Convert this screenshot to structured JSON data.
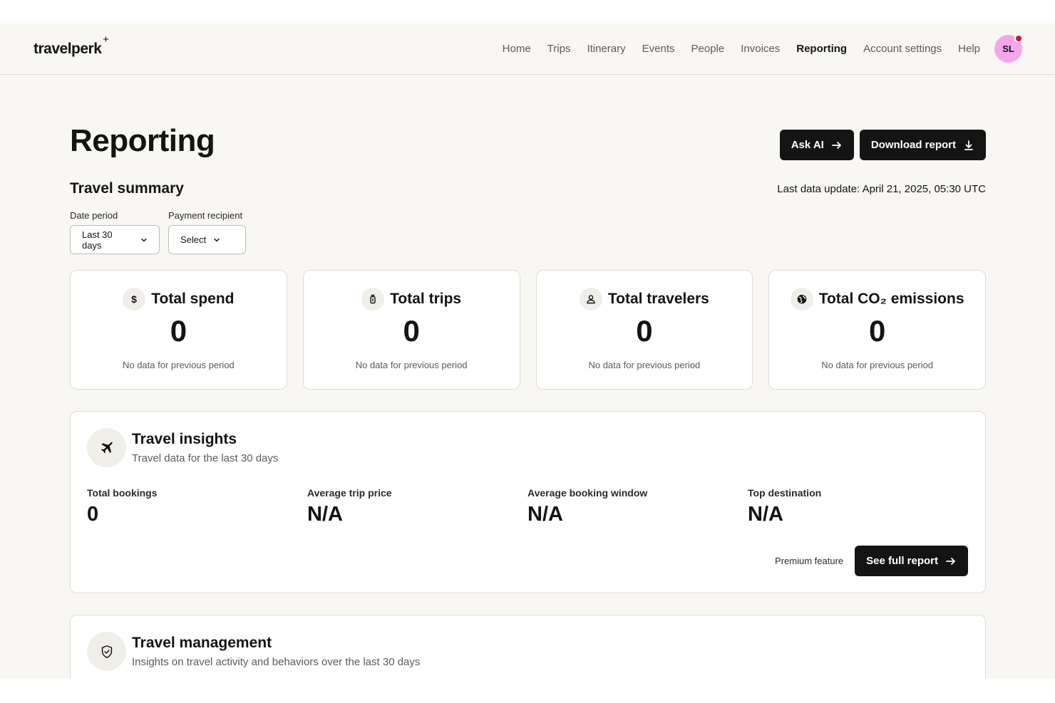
{
  "header": {
    "logo": "travelperk",
    "logo_mark": "+",
    "nav": [
      {
        "label": "Home",
        "active": false
      },
      {
        "label": "Trips",
        "active": false
      },
      {
        "label": "Itinerary",
        "active": false
      },
      {
        "label": "Events",
        "active": false
      },
      {
        "label": "People",
        "active": false
      },
      {
        "label": "Invoices",
        "active": false
      },
      {
        "label": "Reporting",
        "active": true
      },
      {
        "label": "Account settings",
        "active": false
      },
      {
        "label": "Help",
        "active": false
      }
    ],
    "avatar_initials": "SL"
  },
  "page": {
    "title": "Reporting",
    "ask_ai_label": "Ask AI",
    "download_label": "Download report",
    "section_title": "Travel summary",
    "last_update": "Last data update: April 21, 2025, 05:30 UTC"
  },
  "filters": {
    "date_period_label": "Date period",
    "date_period_value": "Last 30 days",
    "payment_label": "Payment recipient",
    "payment_value": "Select"
  },
  "stats": [
    {
      "icon": "dollar-icon",
      "title": "Total spend",
      "value": "0",
      "sub": "No data for previous period"
    },
    {
      "icon": "luggage-icon",
      "title": "Total trips",
      "value": "0",
      "sub": "No data for previous period"
    },
    {
      "icon": "person-icon",
      "title": "Total travelers",
      "value": "0",
      "sub": "No data for previous period"
    },
    {
      "icon": "globe-icon",
      "title": "Total CO₂ emissions",
      "value": "0",
      "sub": "No data for previous period"
    }
  ],
  "insights": {
    "icon": "airplane-icon",
    "title": "Travel insights",
    "subtitle": "Travel data for the last 30 days",
    "metrics": [
      {
        "label": "Total bookings",
        "value": "0"
      },
      {
        "label": "Average trip price",
        "value": "N/A"
      },
      {
        "label": "Average booking window",
        "value": "N/A"
      },
      {
        "label": "Top destination",
        "value": "N/A"
      }
    ],
    "premium_label": "Premium feature",
    "full_report_label": "See full report"
  },
  "management": {
    "icon": "shield-icon",
    "title": "Travel management",
    "subtitle": "Insights on travel activity and behaviors over the last 30 days"
  },
  "colors": {
    "accent": "#141414",
    "avatar": "#f3a7ea",
    "notification": "#d0103a",
    "background": "#f8f7f3"
  }
}
